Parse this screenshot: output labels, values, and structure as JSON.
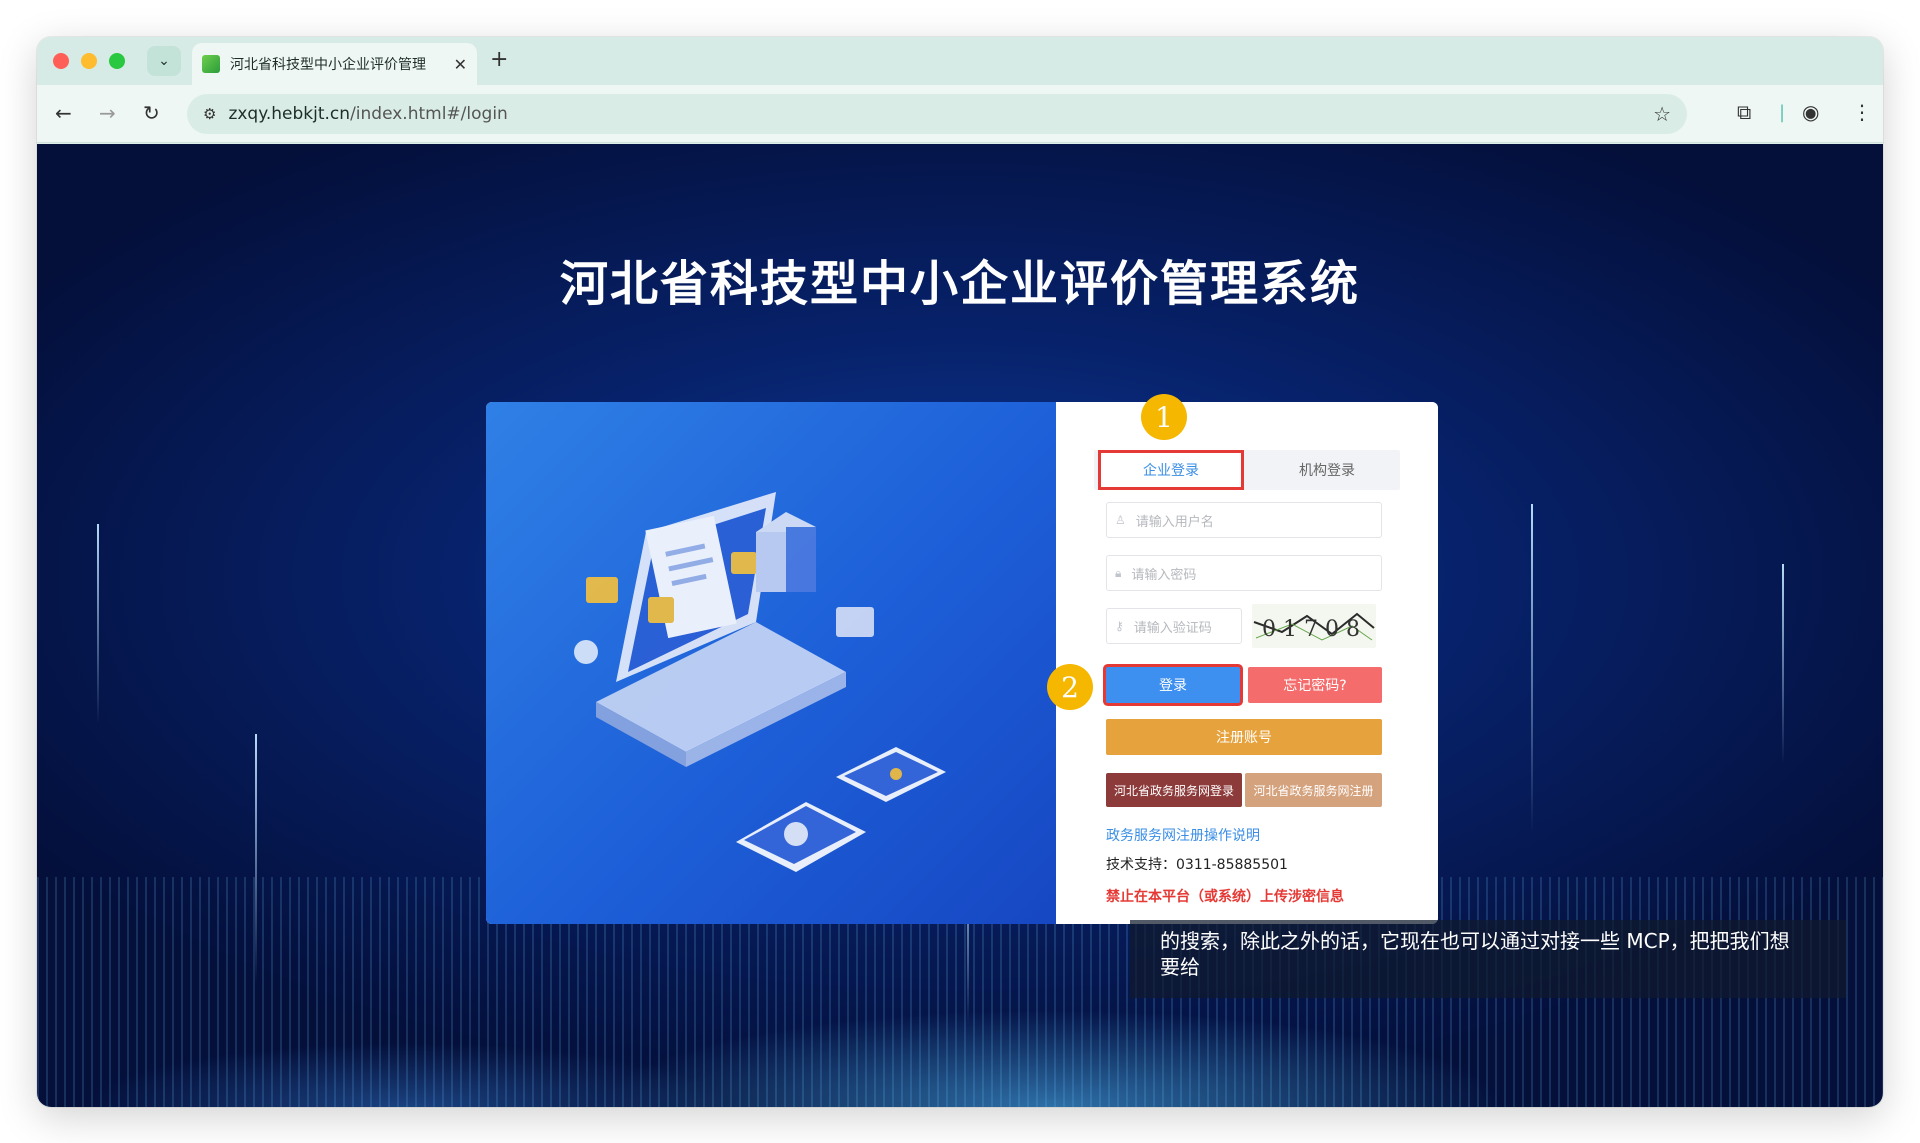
{
  "browser": {
    "tab_title": "河北省科技型中小企业评价管理",
    "tab_close": "✕",
    "new_tab": "+",
    "url_host": "zxqy.hebkjt.cn",
    "url_path": "/index.html#/login"
  },
  "page": {
    "title": "河北省科技型中小企业评价管理系统"
  },
  "login": {
    "tabs": [
      "企业登录",
      "机构登录"
    ],
    "username_placeholder": "请输入用户名",
    "password_placeholder": "请输入密码",
    "captcha_placeholder": "请输入验证码",
    "captcha_text": "0 1 7 0 8",
    "login_button": "登录",
    "forget_button": "忘记密码?",
    "register_button": "注册账号",
    "gov_login_button": "河北省政务服务网登录",
    "gov_register_button": "河北省政务服务网注册",
    "guide_link": "政务服务网注册操作说明",
    "support_text": "技术支持：0311-85885501",
    "warning_text": "禁止在本平台（或系统）上传涉密信息"
  },
  "annotations": {
    "badge1": "1",
    "badge2": "2"
  },
  "subtitle": {
    "line1": "的搜索，除此之外的话，它现在也可以通过对接一些 MCP，把把我们想",
    "line2": "要给"
  },
  "colors": {
    "primary": "#3d8ff0",
    "danger": "#f56c6c",
    "warning": "#e6a23c",
    "highlight_box": "#e53935",
    "badge": "#f5b700"
  }
}
